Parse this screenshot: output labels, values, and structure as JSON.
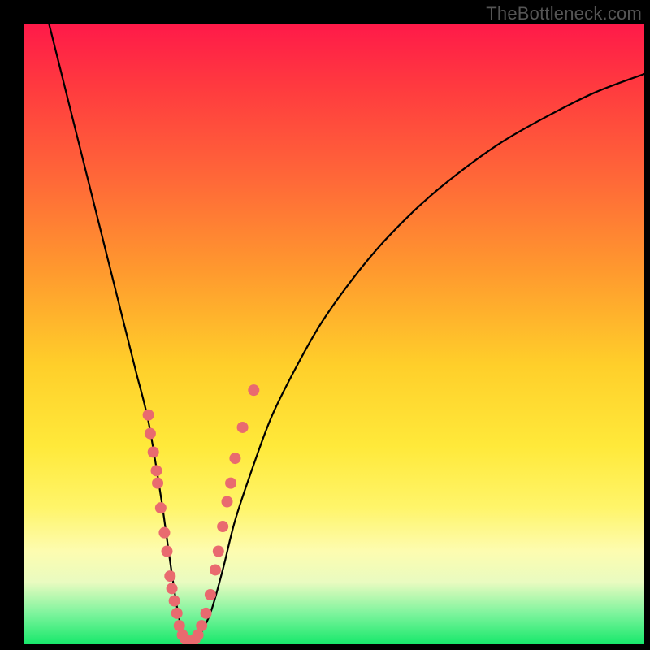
{
  "watermark": {
    "text": "TheBottleneck.com"
  },
  "chart_data": {
    "type": "line",
    "title": "",
    "xlabel": "",
    "ylabel": "",
    "xlim": [
      0,
      100
    ],
    "ylim": [
      0,
      100
    ],
    "series": [
      {
        "name": "bottleneck-curve",
        "x": [
          4,
          6,
          8,
          10,
          12,
          14,
          16,
          18,
          20,
          22,
          23,
          24,
          25,
          26,
          27,
          28,
          30,
          32,
          34,
          37,
          40,
          44,
          48,
          53,
          58,
          64,
          70,
          77,
          84,
          92,
          100
        ],
        "y": [
          100,
          92,
          84,
          76,
          68,
          60,
          52,
          44,
          36,
          24,
          17,
          10,
          4,
          1,
          0,
          1,
          5,
          12,
          20,
          29,
          37,
          45,
          52,
          59,
          65,
          71,
          76,
          81,
          85,
          89,
          92
        ]
      }
    ],
    "markers": [
      {
        "name": "sample-points",
        "color": "#e96a6f",
        "points": [
          {
            "x": 20.0,
            "y": 37
          },
          {
            "x": 20.3,
            "y": 34
          },
          {
            "x": 20.8,
            "y": 31
          },
          {
            "x": 21.3,
            "y": 28
          },
          {
            "x": 21.5,
            "y": 26
          },
          {
            "x": 22.0,
            "y": 22
          },
          {
            "x": 22.6,
            "y": 18
          },
          {
            "x": 23.0,
            "y": 15
          },
          {
            "x": 23.5,
            "y": 11
          },
          {
            "x": 23.8,
            "y": 9
          },
          {
            "x": 24.2,
            "y": 7
          },
          {
            "x": 24.6,
            "y": 5
          },
          {
            "x": 25.0,
            "y": 3
          },
          {
            "x": 25.5,
            "y": 1.5
          },
          {
            "x": 26.0,
            "y": 0.8
          },
          {
            "x": 26.5,
            "y": 0.5
          },
          {
            "x": 27.0,
            "y": 0.5
          },
          {
            "x": 27.5,
            "y": 0.8
          },
          {
            "x": 28.0,
            "y": 1.5
          },
          {
            "x": 28.6,
            "y": 3
          },
          {
            "x": 29.3,
            "y": 5
          },
          {
            "x": 30.0,
            "y": 8
          },
          {
            "x": 30.8,
            "y": 12
          },
          {
            "x": 31.3,
            "y": 15
          },
          {
            "x": 32.0,
            "y": 19
          },
          {
            "x": 32.7,
            "y": 23
          },
          {
            "x": 33.3,
            "y": 26
          },
          {
            "x": 34.0,
            "y": 30
          },
          {
            "x": 35.2,
            "y": 35
          },
          {
            "x": 37.0,
            "y": 41
          }
        ]
      }
    ]
  }
}
